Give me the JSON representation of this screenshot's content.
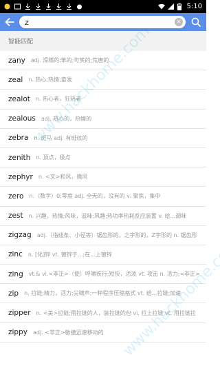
{
  "status": {
    "time": "5:10"
  },
  "search": {
    "value": "z"
  },
  "section": {
    "title": "智能匹配"
  },
  "results": [
    {
      "word": "zany",
      "def": "adj. 滑稽的;笨的;可笑的;荒唐的"
    },
    {
      "word": "zeal",
      "def": "n. 热心;热情;奋发"
    },
    {
      "word": "zealot",
      "def": "n. 热心者，狂热者"
    },
    {
      "word": "zealous",
      "def": "adj. 热心的，热情的"
    },
    {
      "word": "zebra",
      "def": "n. 斑马 adj. 有斑纹的"
    },
    {
      "word": "zenith",
      "def": "n. 顶点，极点"
    },
    {
      "word": "zephyr",
      "def": "n. <文>和风，微风"
    },
    {
      "word": "zero",
      "def": "n.（数字）0;零度 adj. 全无的，没有的 v.   聚焦，集中"
    },
    {
      "word": "zest",
      "def": "n. 兴趣，热情;风味，滋味;风趣;热功率热耗反应装置 v. 给...调味"
    },
    {
      "word": "zigzag",
      "def": "adj.（指线条、小径等）锯齿形的，之字形的，Z字形的 n. 锯齿形"
    },
    {
      "word": "zinc",
      "def": "n. [化]锌 vt. 镀锌于...;在...上镀锌"
    },
    {
      "word": "zing",
      "def": "vt.& vi.<非正>（使）呼啸疾行;短快，活泼 vt. 攻击 n.   活力;<非正>"
    },
    {
      "word": "zip",
      "def": "n. 拉链;精力，活力;尖啸声;一种程序压缩格式 vt.  给...拉链;加速"
    },
    {
      "word": "zipper",
      "def": "n. <美>拉链;用拉链的人，装拉链的包 vi. 拉上拉链 vt. 用拉链拉"
    },
    {
      "word": "zippy",
      "def": "adj. <非正>敏捷迅速移动的"
    }
  ],
  "watermark": {
    "text": "www.hackhome.com"
  },
  "icons": {
    "back": "arrow-left-icon",
    "clear": "clear-icon",
    "search": "search-icon"
  },
  "colors": {
    "appbar": "#5a8ee8",
    "section_bg": "#f2f2f2"
  }
}
